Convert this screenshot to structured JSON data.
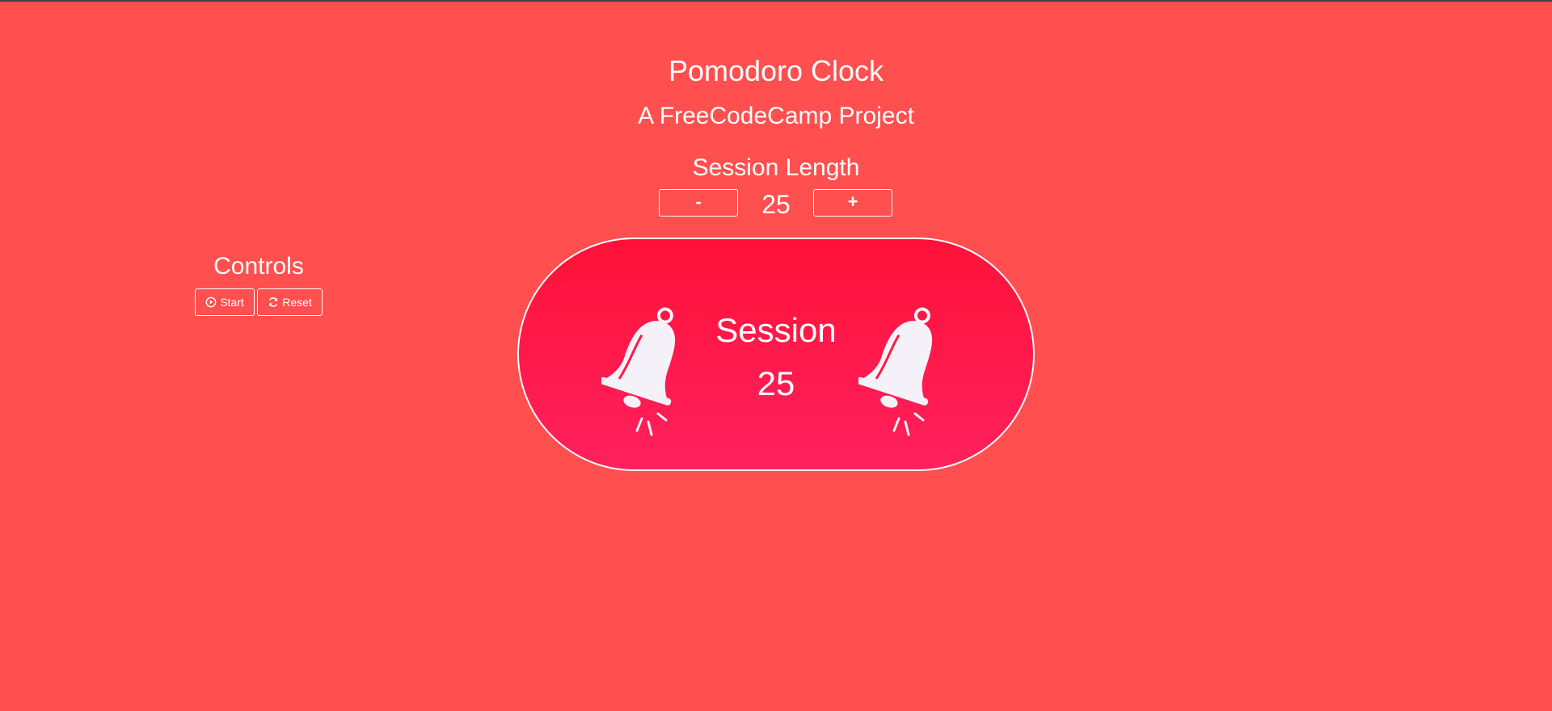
{
  "header": {
    "title": "Pomodoro Clock",
    "subtitle": "A FreeCodeCamp Project"
  },
  "session_length": {
    "label": "Session Length",
    "decrement_label": "-",
    "increment_label": "+",
    "value": "25"
  },
  "controls": {
    "label": "Controls",
    "start_label": "Start",
    "reset_label": "Reset",
    "start_icon": "play-circle-icon",
    "reset_icon": "refresh-icon"
  },
  "clock": {
    "label": "Session",
    "value": "25",
    "icon": "bell-icon"
  },
  "colors": {
    "background": "#ff4f4f",
    "clock_gradient_top": "#ff1238",
    "clock_gradient_bottom": "#ff205d",
    "text": "#ffffff"
  }
}
